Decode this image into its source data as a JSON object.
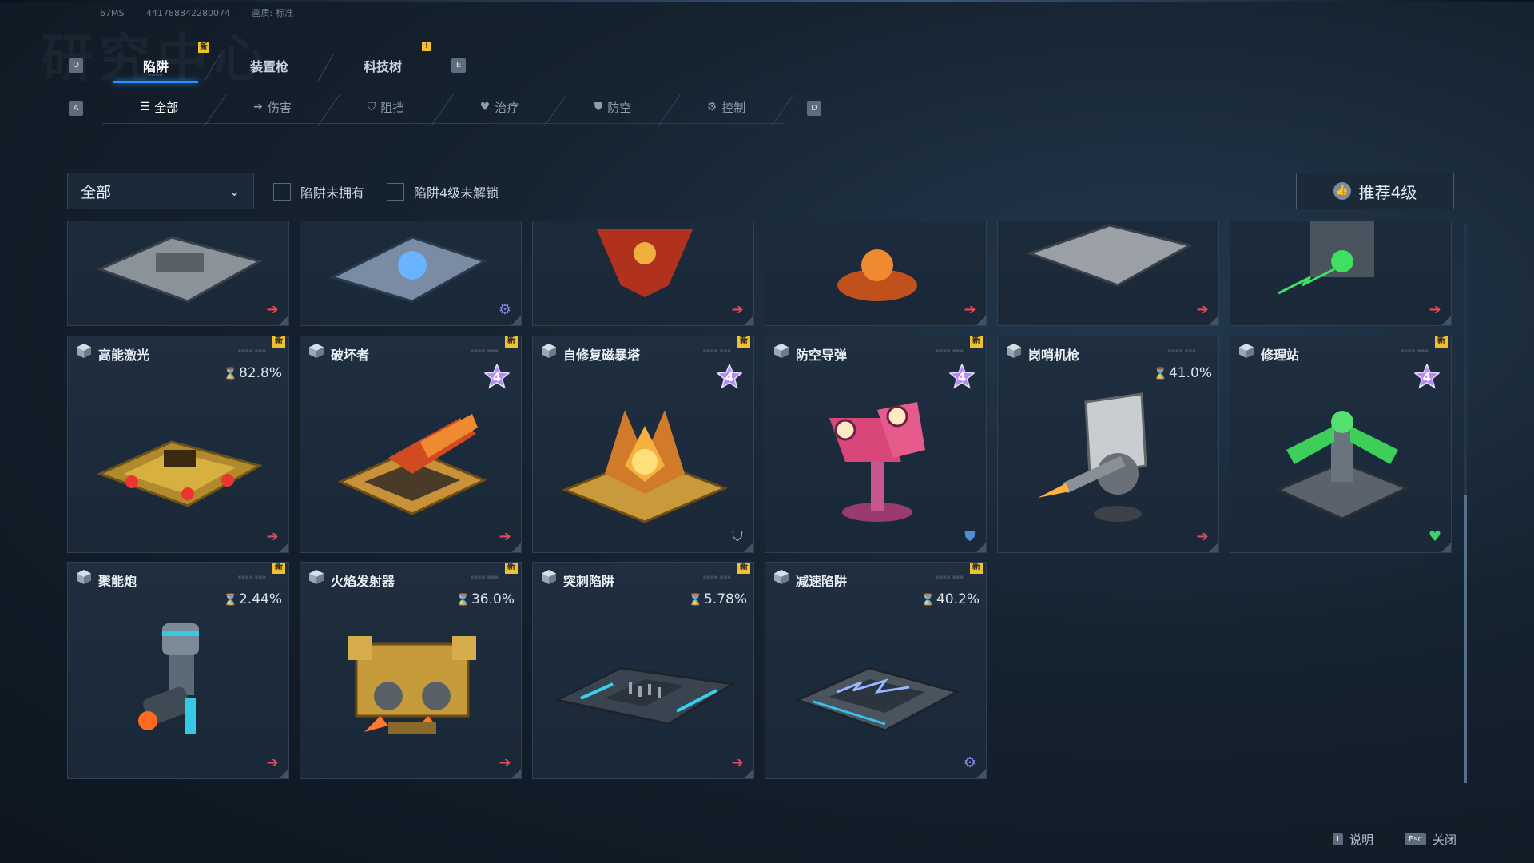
{
  "meta": {
    "perf": "67MS",
    "id": "441788842280074",
    "quality_label": "画质:",
    "quality_value": "标准"
  },
  "watermark": "研究中心",
  "keys": {
    "prev_tab": "Q",
    "next_tab": "E",
    "prev_cat": "A",
    "next_cat": "D"
  },
  "tabs": [
    {
      "label": "陷阱",
      "badge": "新",
      "active": true
    },
    {
      "label": "装置枪",
      "active": false
    },
    {
      "label": "科技树",
      "badge": "!",
      "active": false
    }
  ],
  "categories": [
    {
      "label": "全部",
      "icon": "list-icon",
      "glyph": "☰",
      "active": true
    },
    {
      "label": "伤害",
      "icon": "arrow-right-icon",
      "glyph": "➔",
      "active": false
    },
    {
      "label": "阻挡",
      "icon": "shield-icon",
      "glyph": "⛉",
      "active": false
    },
    {
      "label": "治疗",
      "icon": "heart-icon",
      "glyph": "♥",
      "active": false
    },
    {
      "label": "防空",
      "icon": "air-shield-icon",
      "glyph": "⛊",
      "active": false
    },
    {
      "label": "控制",
      "icon": "gear-icon",
      "glyph": "⚙",
      "active": false
    }
  ],
  "filters": {
    "dropdown_value": "全部",
    "check_not_owned": "陷阱未拥有",
    "check_lvl4_locked": "陷阱4级未解锁",
    "recommend": "推荐4级"
  },
  "top_row_actions": [
    "arrow",
    "gear",
    "arrow",
    "arrow",
    "arrow",
    "arrow"
  ],
  "cards": [
    {
      "name": "高能激光",
      "badge": "新",
      "progress": "82.8%",
      "level4": false,
      "action": "arrow",
      "art": "laser"
    },
    {
      "name": "破坏者",
      "badge": "新",
      "progress": "",
      "level4": true,
      "action": "arrow",
      "art": "breaker"
    },
    {
      "name": "自修复磁暴塔",
      "badge": "新",
      "progress": "",
      "level4": true,
      "action": "shield",
      "art": "tesla"
    },
    {
      "name": "防空导弹",
      "badge": "新",
      "progress": "",
      "level4": true,
      "action": "sshield",
      "art": "missile"
    },
    {
      "name": "岗哨机枪",
      "badge": "",
      "progress": "41.0%",
      "level4": false,
      "action": "arrow",
      "art": "sentry"
    },
    {
      "name": "修理站",
      "badge": "新",
      "progress": "",
      "level4": true,
      "action": "heart",
      "art": "repair"
    },
    {
      "name": "聚能炮",
      "badge": "新",
      "progress": "2.44%",
      "level4": false,
      "action": "arrow",
      "art": "cannon"
    },
    {
      "name": "火焰发射器",
      "badge": "新",
      "progress": "36.0%",
      "level4": false,
      "action": "arrow",
      "art": "flame"
    },
    {
      "name": "突刺陷阱",
      "badge": "新",
      "progress": "5.78%",
      "level4": false,
      "action": "arrow",
      "art": "spike"
    },
    {
      "name": "减速陷阱",
      "badge": "新",
      "progress": "40.2%",
      "level4": false,
      "action": "gear",
      "art": "slow"
    }
  ],
  "footer": {
    "help_key": "I",
    "help_label": "说明",
    "close_key": "Esc",
    "close_label": "关闭"
  },
  "colors": {
    "accent": "#2f93ff",
    "new_badge": "#f0c030",
    "damage": "#e44a5a",
    "control": "#7f86e8",
    "heal": "#3fd16a",
    "level4": "#b58cf0"
  }
}
